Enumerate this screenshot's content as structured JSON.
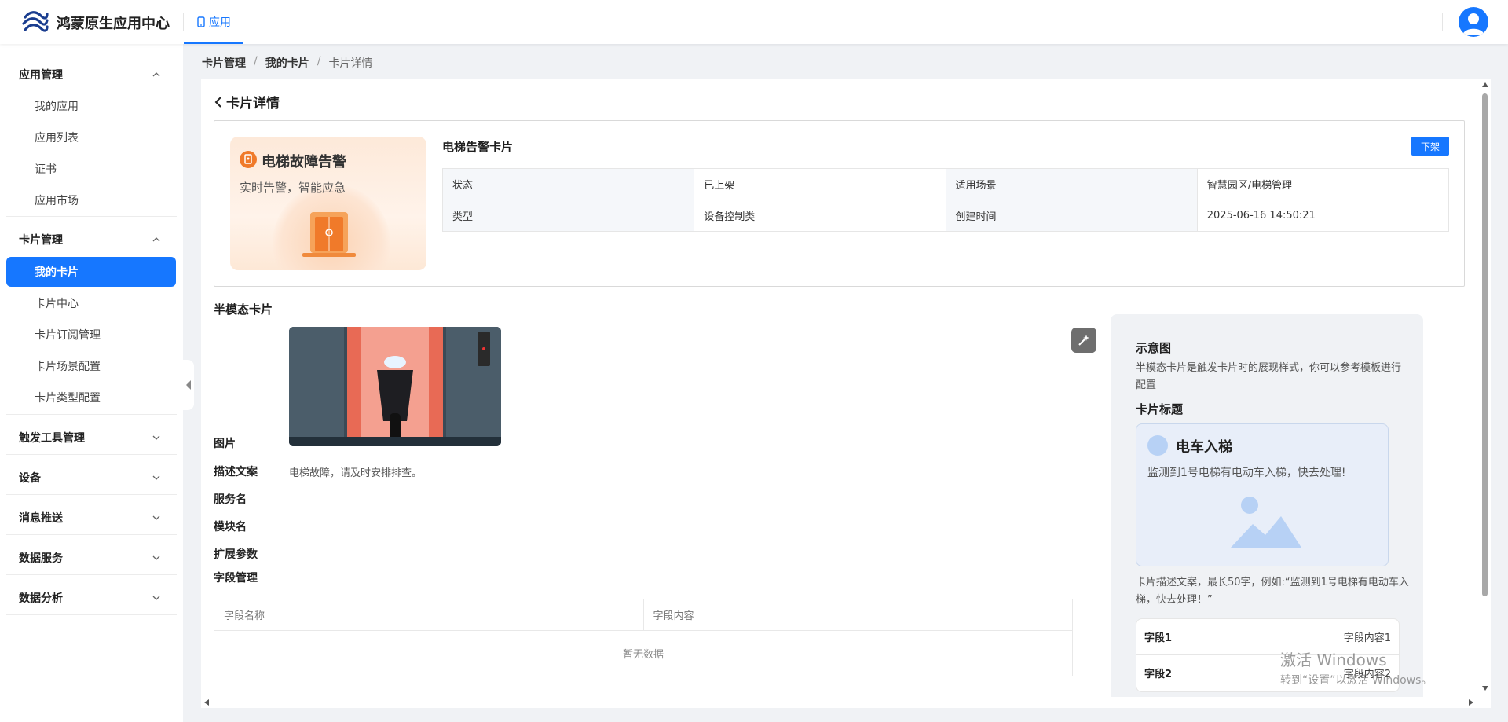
{
  "header": {
    "app_title": "鸿蒙原生应用中心",
    "nav_tab": "应用",
    "logo_icon": "wave-logo-icon",
    "avatar_icon": "user-avatar-icon",
    "accent_color": "#1677ff"
  },
  "sidebar": {
    "groups": [
      {
        "label": "应用管理",
        "expanded": true,
        "items": [
          "我的应用",
          "应用列表",
          "证书",
          "应用市场"
        ]
      },
      {
        "label": "卡片管理",
        "expanded": true,
        "items": [
          "我的卡片",
          "卡片中心",
          "卡片订阅管理",
          "卡片场景配置",
          "卡片类型配置"
        ],
        "active": "我的卡片"
      },
      {
        "label": "触发工具管理",
        "expanded": false
      },
      {
        "label": "设备",
        "expanded": false
      },
      {
        "label": "消息推送",
        "expanded": false
      },
      {
        "label": "数据服务",
        "expanded": false
      },
      {
        "label": "数据分析",
        "expanded": false
      }
    ]
  },
  "breadcrumb": [
    "卡片管理",
    "我的卡片",
    "卡片详情"
  ],
  "page": {
    "title": "卡片详情",
    "thumbnail": {
      "title": "电梯故障告警",
      "subtitle": "实时告警，智能应急"
    },
    "card_name": "电梯告警卡片",
    "offshelf_button": "下架",
    "info": {
      "status_label": "状态",
      "status_value": "已上架",
      "scene_label": "适用场景",
      "scene_value": "智慧园区/电梯管理",
      "type_label": "类型",
      "type_value": "设备控制类",
      "created_label": "创建时间",
      "created_value": "2025-06-16 14:50:21"
    },
    "half_modal": {
      "section_title": "半模态卡片",
      "image_label": "图片",
      "desc_label": "描述文案",
      "desc_value": "电梯故障，请及时安排排查。",
      "service_label": "服务名",
      "module_label": "模块名",
      "ext_label": "扩展参数",
      "field_mgmt_label": "字段管理",
      "field_table": {
        "col_name": "字段名称",
        "col_content": "字段内容",
        "empty": "暂无数据"
      }
    },
    "preview": {
      "title": "示意图",
      "desc": "半模态卡片是触发卡片时的展现样式，你可以参考模板进行配置",
      "card_title_label": "卡片标题",
      "sample_title": "电车入梯",
      "sample_text": "监测到1号电梯有电动车入梯，快去处理!",
      "note": "卡片描述文案，最长50字，例如:“监测到1号电梯有电动车入梯，快去处理！”",
      "fields": [
        {
          "k": "字段1",
          "v": "字段内容1"
        },
        {
          "k": "字段2",
          "v": "字段内容2"
        }
      ]
    }
  },
  "watermark": {
    "line1": "激活 Windows",
    "line2": "转到“设置”以激活 Windows。"
  }
}
